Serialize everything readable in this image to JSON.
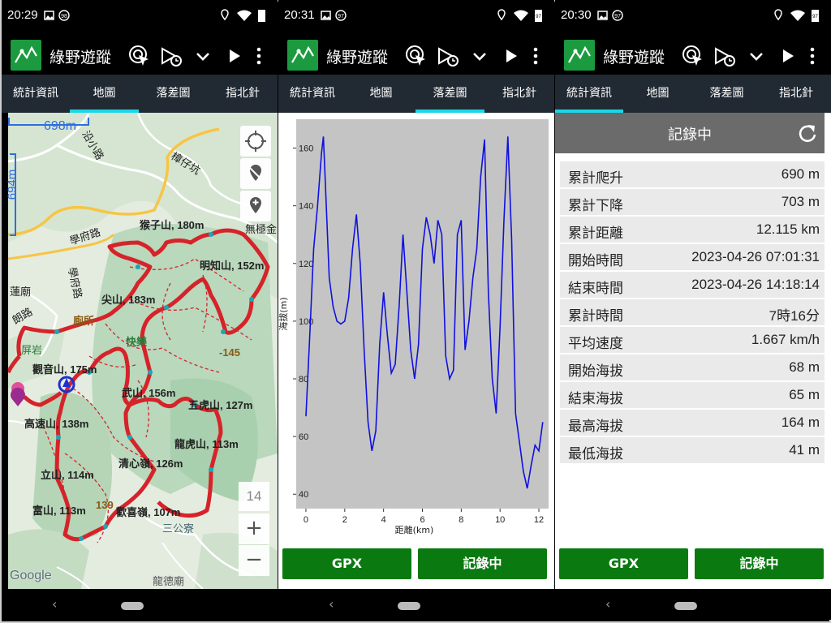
{
  "app": {
    "title": "綠野遊蹤"
  },
  "colors": {
    "tab_indicator": "#19d7e8",
    "track": "#d6232a",
    "profile_line": "#1010e0",
    "button_green": "#0a7a10",
    "logo_green": "#1c9a3f"
  },
  "panels": [
    {
      "status": {
        "time": "20:29",
        "badge": "98",
        "battery": ""
      },
      "tabs": [
        "統計資訊",
        "地圖",
        "落差圖",
        "指北針"
      ],
      "active_tab": 1
    },
    {
      "status": {
        "time": "20:31",
        "badge": "97",
        "battery": "97"
      },
      "tabs": [
        "統計資訊",
        "地圖",
        "落差圖",
        "指北針"
      ],
      "active_tab": 2
    },
    {
      "status": {
        "time": "20:30",
        "badge": "97",
        "battery": "97"
      },
      "tabs": [
        "統計資訊",
        "地圖",
        "落差圖",
        "指北針"
      ],
      "active_tab": 0
    }
  ],
  "map": {
    "scale_h": "698m",
    "scale_v": "694m",
    "zoom_level": "14",
    "zoom_in": "+",
    "zoom_out": "−",
    "google": "Google",
    "labels": [
      "猴子山, 180m",
      "學府路",
      "無極金",
      "明知山, 152m",
      "樟仔坑",
      "尖山, 183m",
      "廁所",
      "快樂",
      "-145",
      "觀音山, 175m",
      "武山, 156m",
      "五虎山, 127m",
      "高速山, 138m",
      "龍虎山, 113m",
      "清心嶺, 126m",
      "立山, 114m",
      "富山, 113m",
      "139",
      "歡喜嶺, 107m",
      "三公寮",
      "龍德廟",
      "蓮廟",
      "朗路",
      "屏岩",
      "學府路",
      "沿小路"
    ]
  },
  "chart_data": {
    "type": "line",
    "xlabel": "距離(km)",
    "ylabel": "海拔(m)",
    "xlim": [
      -0.5,
      12.5
    ],
    "ylim": [
      35,
      170
    ],
    "x_ticks": [
      0,
      2,
      4,
      6,
      8,
      10,
      12
    ],
    "y_ticks": [
      40,
      60,
      80,
      100,
      120,
      140,
      160
    ],
    "series": [
      {
        "x": [
          0,
          0.2,
          0.4,
          0.6,
          0.8,
          0.9,
          1.0,
          1.2,
          1.4,
          1.6,
          1.8,
          2.0,
          2.2,
          2.4,
          2.6,
          2.8,
          3.0,
          3.2,
          3.4,
          3.6,
          3.8,
          4.0,
          4.2,
          4.4,
          4.6,
          4.8,
          5.0,
          5.2,
          5.4,
          5.6,
          5.8,
          6.0,
          6.2,
          6.4,
          6.6,
          6.8,
          7.0,
          7.2,
          7.4,
          7.6,
          7.8,
          8.0,
          8.2,
          8.4,
          8.6,
          8.8,
          9.0,
          9.2,
          9.4,
          9.6,
          9.8,
          10.0,
          10.2,
          10.4,
          10.6,
          10.8,
          11.0,
          11.2,
          11.4,
          11.6,
          11.8,
          12.0,
          12.2
        ],
        "y": [
          67,
          95,
          125,
          140,
          158,
          164,
          148,
          115,
          105,
          100,
          99,
          100,
          108,
          125,
          137,
          120,
          90,
          65,
          55,
          62,
          92,
          110,
          95,
          82,
          85,
          105,
          130,
          110,
          90,
          80,
          92,
          125,
          136,
          130,
          120,
          135,
          130,
          88,
          80,
          83,
          130,
          135,
          90,
          100,
          115,
          125,
          150,
          163,
          110,
          80,
          68,
          98,
          135,
          164,
          128,
          68,
          58,
          48,
          42,
          50,
          57,
          55,
          65
        ]
      }
    ]
  },
  "buttons": {
    "gpx": "GPX",
    "recording": "記錄中"
  },
  "stats": {
    "header": "記錄中",
    "rows": [
      {
        "label": "累計爬升",
        "value": "690 m"
      },
      {
        "label": "累計下降",
        "value": "703 m"
      },
      {
        "label": "累計距離",
        "value": "12.115 km"
      },
      {
        "label": "開始時間",
        "value": "2023-04-26 07:01:31"
      },
      {
        "label": "結束時間",
        "value": "2023-04-26 14:18:14"
      },
      {
        "label": "累計時間",
        "value": "7時16分"
      },
      {
        "label": "平均速度",
        "value": "1.667 km/h"
      },
      {
        "label": "開始海拔",
        "value": "68 m"
      },
      {
        "label": "結束海拔",
        "value": "65 m"
      },
      {
        "label": "最高海拔",
        "value": "164 m"
      },
      {
        "label": "最低海拔",
        "value": "41 m"
      }
    ]
  }
}
